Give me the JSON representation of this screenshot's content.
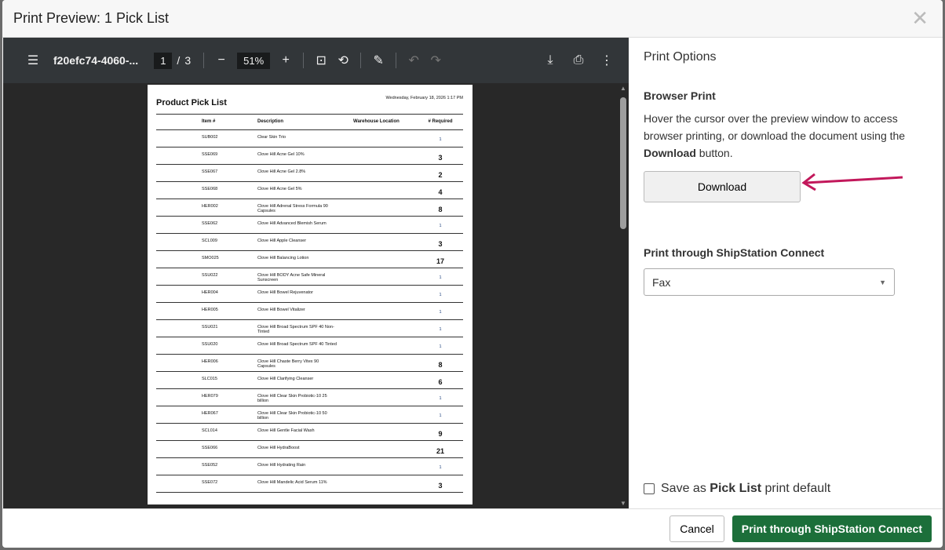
{
  "title": "Print Preview: 1 Pick List",
  "viewer": {
    "filename": "f20efc74-4060-...",
    "page": "1",
    "page_sep": "/",
    "pages": "3",
    "zoom": "51%"
  },
  "doc": {
    "title": "Product Pick List",
    "date": "Wednesday, February 18, 2026 1:17 PM",
    "headers": [
      "Item #",
      "Description",
      "Warehouse Location",
      "# Required"
    ],
    "rows": [
      [
        "SUB002",
        "Clear Skin Trio",
        "",
        "1"
      ],
      [
        "SSE069",
        "Clove Hill Acne Gel 10%",
        "",
        "3"
      ],
      [
        "SSE067",
        "Clove Hill Acne Gel 2.8%",
        "",
        "2"
      ],
      [
        "SSE068",
        "Clove Hill Acne Gel 5%",
        "",
        "4"
      ],
      [
        "HER002",
        "Clove Hill Adrenal Stress Formula 90 Capsules",
        "",
        "8"
      ],
      [
        "SSE062",
        "Clove Hill Advanced Blemish Serum",
        "",
        "1"
      ],
      [
        "SCL009",
        "Clove Hill Apple Cleanser",
        "",
        "3"
      ],
      [
        "SMO025",
        "Clove Hill Balancing Lotion",
        "",
        "17"
      ],
      [
        "SSU022",
        "Clove Hill BODY Acne Safe Mineral Sunscreen",
        "",
        "1"
      ],
      [
        "HER004",
        "Clove Hill Bowel Rejuvenator",
        "",
        "1"
      ],
      [
        "HER005",
        "Clove Hill Bowel Vitalizer",
        "",
        "1"
      ],
      [
        "SSU021",
        "Clove Hill Broad Spectrum SPF 40 Non-Tinted",
        "",
        "1"
      ],
      [
        "SSU020",
        "Clove Hill Broad Spectrum SPF 40 Tinted",
        "",
        "1"
      ],
      [
        "HER006",
        "Clove Hill Chaste Berry Vitex 90 Capsules",
        "",
        "8"
      ],
      [
        "SLC015",
        "Clove Hill Clarifying Cleanser",
        "",
        "6"
      ],
      [
        "HER079",
        "Clove Hill Clear Skin Probiotic-10 25 billion",
        "",
        "1"
      ],
      [
        "HER067",
        "Clove Hill Clear Skin Probiotic-10 50 billion",
        "",
        "1"
      ],
      [
        "SCL014",
        "Clove Hill Gentle Facial Wash",
        "",
        "9"
      ],
      [
        "SSE066",
        "Clove Hill HydraBoost",
        "",
        "21"
      ],
      [
        "SSE052",
        "Clove Hill Hydrating Rain",
        "",
        "1"
      ],
      [
        "SSE072",
        "Clove Hill Mandelic Acid Serum 11%",
        "",
        "3"
      ]
    ]
  },
  "options": {
    "heading": "Print Options",
    "browser_heading": "Browser Print",
    "browser_text_1": "Hover the cursor over the preview window to access browser printing, or download the document using the ",
    "browser_text_bold": "Download",
    "browser_text_2": " button.",
    "download": "Download",
    "connect_heading": "Print through ShipStation Connect",
    "printer": "Fax",
    "default_pre": "Save as ",
    "default_bold": "Pick List",
    "default_post": " print default"
  },
  "footer": {
    "cancel": "Cancel",
    "print": "Print through ShipStation Connect"
  },
  "colors": {
    "primary": "#1c6f3a",
    "arrow": "#c2185b"
  }
}
